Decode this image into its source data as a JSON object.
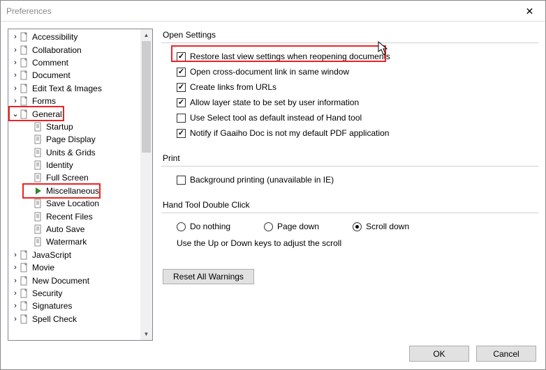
{
  "title": "Preferences",
  "sidebar": {
    "items": [
      {
        "label": "Accessibility",
        "type": "top"
      },
      {
        "label": "Collaboration",
        "type": "top"
      },
      {
        "label": "Comment",
        "type": "top"
      },
      {
        "label": "Document",
        "type": "top"
      },
      {
        "label": "Edit Text & Images",
        "type": "top"
      },
      {
        "label": "Forms",
        "type": "top"
      },
      {
        "label": "General",
        "type": "top",
        "expanded": true,
        "highlight": true
      },
      {
        "label": "Startup",
        "type": "child"
      },
      {
        "label": "Page Display",
        "type": "child"
      },
      {
        "label": "Units & Grids",
        "type": "child"
      },
      {
        "label": "Identity",
        "type": "child"
      },
      {
        "label": "Full Screen",
        "type": "child"
      },
      {
        "label": "Miscellaneous",
        "type": "child",
        "active": true,
        "highlight": true
      },
      {
        "label": "Save Location",
        "type": "child"
      },
      {
        "label": "Recent Files",
        "type": "child"
      },
      {
        "label": "Auto Save",
        "type": "child"
      },
      {
        "label": "Watermark",
        "type": "child"
      },
      {
        "label": "JavaScript",
        "type": "top"
      },
      {
        "label": "Movie",
        "type": "top"
      },
      {
        "label": "New Document",
        "type": "top"
      },
      {
        "label": "Security",
        "type": "top"
      },
      {
        "label": "Signatures",
        "type": "top"
      },
      {
        "label": "Spell Check",
        "type": "top"
      }
    ],
    "highlight_color": "#e22222"
  },
  "groups": {
    "open_settings": {
      "title": "Open Settings",
      "checks": [
        {
          "label": "Restore last view settings when reopening documents",
          "checked": true,
          "highlight": true
        },
        {
          "label": "Open cross-document link in same window",
          "checked": true
        },
        {
          "label": "Create links from URLs",
          "checked": true
        },
        {
          "label": "Allow layer state to be set by user information",
          "checked": true
        },
        {
          "label": "Use Select tool as default instead of Hand tool",
          "checked": false
        },
        {
          "label": "Notify if Gaaiho Doc is not my default PDF application",
          "checked": true
        }
      ]
    },
    "print": {
      "title": "Print",
      "checks": [
        {
          "label": "Background printing (unavailable in IE)",
          "checked": false
        }
      ]
    },
    "hand_tool": {
      "title": "Hand Tool Double Click",
      "radios": [
        {
          "label": "Do nothing",
          "selected": false
        },
        {
          "label": "Page down",
          "selected": false
        },
        {
          "label": "Scroll down",
          "selected": true
        }
      ],
      "hint": "Use the Up or Down keys to adjust the scroll"
    }
  },
  "reset_label": "Reset All Warnings",
  "buttons": {
    "ok": "OK",
    "cancel": "Cancel"
  }
}
